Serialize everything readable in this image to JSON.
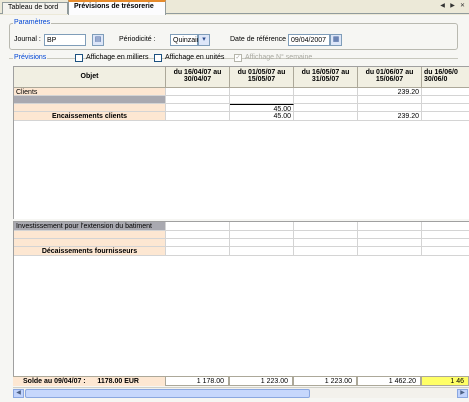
{
  "tabs": [
    {
      "label": "Tableau de bord"
    },
    {
      "label": "Prévisions de trésorerie"
    }
  ],
  "parameters": {
    "legend": "Paramètres",
    "journal_label": "Journal :",
    "journal_value": "BP",
    "periodicite_label": "Périodicité :",
    "periodicite_value": "Quinzaine",
    "date_label": "Date de référence :",
    "date_value": "09/04/2007"
  },
  "previsions": {
    "legend": "Prévisions",
    "options": [
      {
        "label": "Affichage en milliers",
        "checked": false,
        "enabled": true
      },
      {
        "label": "Affichage en unités",
        "checked": false,
        "enabled": true
      },
      {
        "label": "Affichage N° semaine",
        "checked": true,
        "enabled": false
      }
    ]
  },
  "grid": {
    "object_header": "Objet",
    "period_headers": [
      [
        "du 16/04/07 au",
        "30/04/07"
      ],
      [
        "du 01/05/07 au",
        "15/05/07"
      ],
      [
        "du 16/05/07 au",
        "31/05/07"
      ],
      [
        "du 01/06/07 au",
        "15/06/07"
      ],
      [
        "du 16/06/0",
        "30/06/0"
      ]
    ],
    "receipts": {
      "clients_label": "Clients",
      "clients_values": [
        "",
        "",
        "",
        "239.20",
        ""
      ],
      "subtotal_values": [
        "",
        "45.00",
        "",
        "",
        ""
      ],
      "total_label": "Encaissements clients",
      "total_values": [
        "45.00",
        "",
        "239.20",
        "",
        ""
      ]
    },
    "disbursements": {
      "line_label": "Investissement pour l'extension du batiment",
      "total_label": "Décaissements fournisseurs"
    }
  },
  "footer": {
    "solde_label": "Solde au 09/04/07 :",
    "solde_value": "1178.00 EUR",
    "balances": [
      "1 178.00",
      "1 223.00",
      "1 223.00",
      "1 462.20",
      "1 46"
    ]
  },
  "colors": {
    "accent_tab": "#e68b2c",
    "group_legend": "#0046d5",
    "label_fill": "#fde7d2",
    "highlight": "#ffff66"
  }
}
